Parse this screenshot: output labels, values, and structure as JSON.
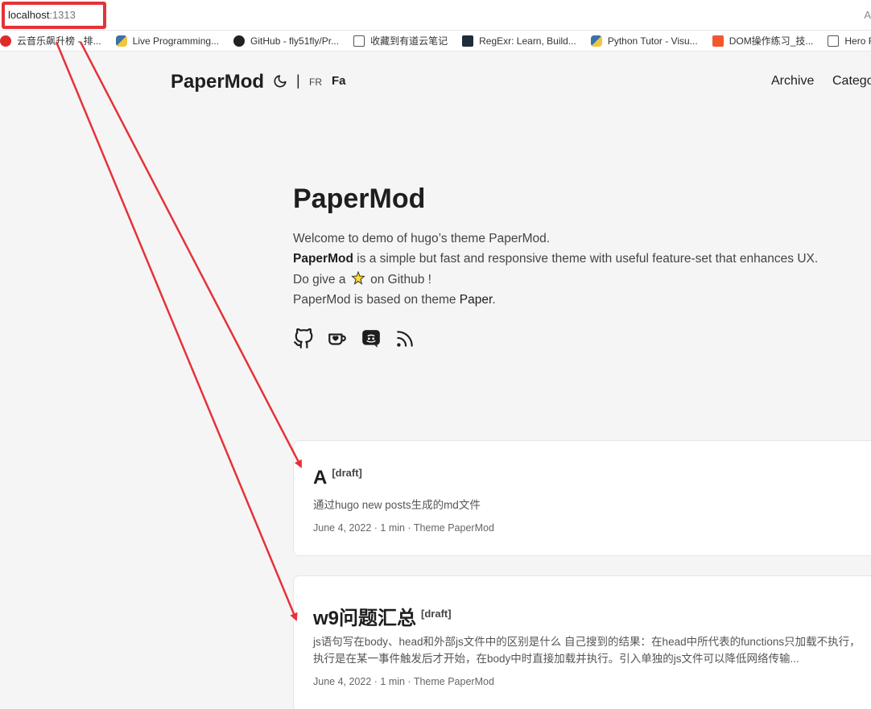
{
  "browser": {
    "url_host": "localhost",
    "url_port": ":1313",
    "url_right": "A"
  },
  "bookmarks": [
    {
      "label": "云音乐飙升榜 - 排...",
      "icon": "netease-music-icon"
    },
    {
      "label": "Live Programming...",
      "icon": "python-icon"
    },
    {
      "label": "GitHub - fly51fly/Pr...",
      "icon": "github-icon"
    },
    {
      "label": "收藏到有道云笔记",
      "icon": "document-icon"
    },
    {
      "label": "RegExr: Learn, Build...",
      "icon": "regexr-icon"
    },
    {
      "label": "Python Tutor - Visu...",
      "icon": "python-icon"
    },
    {
      "label": "DOM操作练习_技...",
      "icon": "csdn-icon"
    },
    {
      "label": "Hero F",
      "icon": "document-icon"
    }
  ],
  "header": {
    "logo": "PaperMod",
    "lang_sep": "|",
    "lang_fr": "FR",
    "lang_fa": "Fa",
    "nav": [
      "Archive",
      "Categories"
    ]
  },
  "home": {
    "title": "PaperMod",
    "line1": "Welcome to demo of hugo’s theme PaperMod.",
    "line2_bold": "PaperMod",
    "line2_rest": " is a simple but fast and responsive theme with useful feature-set that enhances UX.",
    "line3_pre": "Do give a",
    "line3_post": "on Github !",
    "line4_pre": "PaperMod is based on theme ",
    "line4_link": "Paper",
    "line4_post": "."
  },
  "posts": [
    {
      "title": "A",
      "badge": "[draft]",
      "summary": "通过hugo new posts生成的md文件",
      "meta": "June 4, 2022 · 1 min · Theme PaperMod"
    },
    {
      "title": "w9问题汇总",
      "badge": "[draft]",
      "summary": "js语句写在body、head和外部js文件中的区别是什么 自己搜到的结果：在head中所代表的functions只加载不执行，执行是在某一事件触发后才开始，在body中时直接加载并执行。引入单独的js文件可以降低网络传输...",
      "meta": "June 4, 2022 · 1 min · Theme PaperMod"
    }
  ],
  "colors": {
    "annotation": "#e53238",
    "background": "#f5f5f5",
    "card": "#ffffff"
  }
}
